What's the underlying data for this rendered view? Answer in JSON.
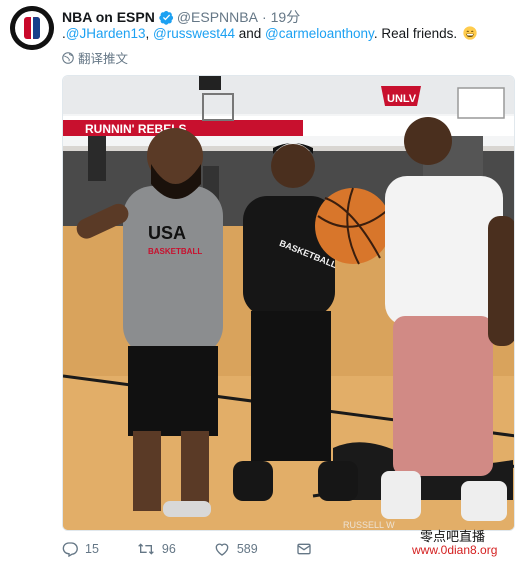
{
  "tweet": {
    "display_name": "NBA on ESPN",
    "handle": "@ESPNNBA",
    "separator": "·",
    "time": "19分",
    "text": {
      "prefix": ".",
      "mention1": "@JHarden13",
      "sep1": ", ",
      "mention2": "@russwest44",
      "sep2": " and ",
      "mention3": "@carmeloanthony",
      "suffix": ". Real friends.",
      "emoji": "grinning-face-emoji"
    },
    "translate_label": "翻译推文",
    "photo": {
      "alt_text": "",
      "wall_banner": "RUNNIN' REBELS",
      "wall_logo": "UNLV",
      "shirt_text_left": "USA BASKETBALL",
      "shirt_text_middle": "BASKETBALL",
      "photo_credit": "RUSSELL W"
    },
    "actions": {
      "reply_count": "15",
      "retweet_count": "96",
      "like_count": "589"
    },
    "icons": {
      "reply": "reply-icon",
      "retweet": "retweet-icon",
      "like": "heart-icon",
      "dm": "mail-icon",
      "verified": "verified-badge-icon",
      "globe": "globe-icon"
    }
  },
  "watermark": {
    "brand": "零点吧直播",
    "url": "www.0dian8.org"
  },
  "colors": {
    "accent": "#1da1f2",
    "muted": "#657786",
    "watermark_red": "#d42020"
  }
}
